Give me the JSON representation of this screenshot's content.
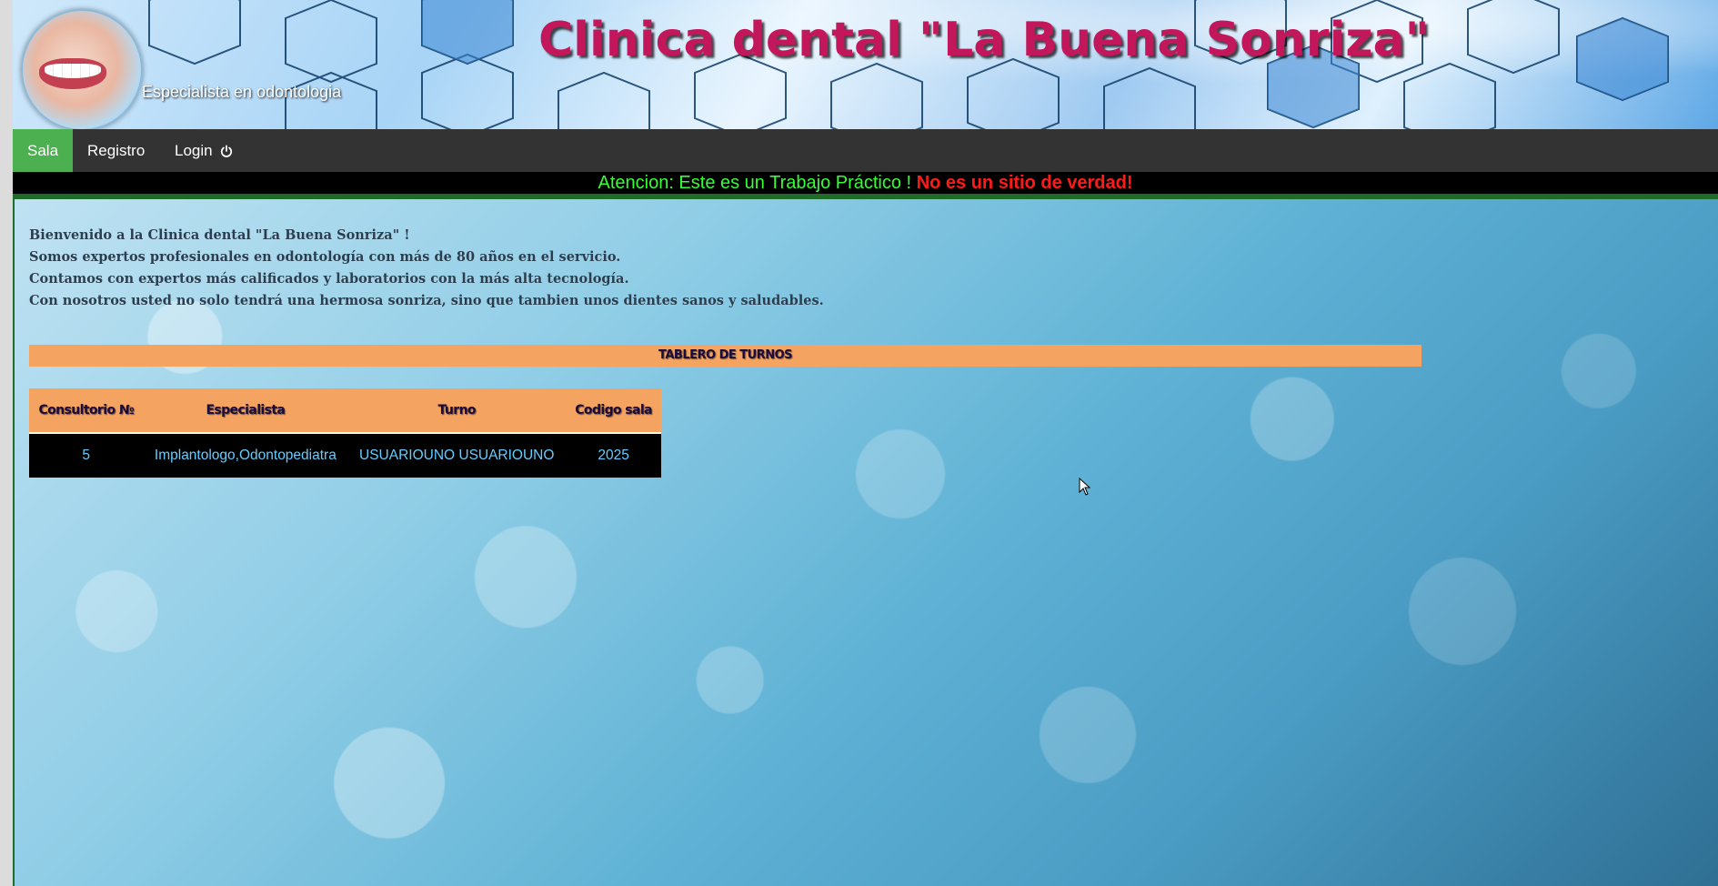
{
  "header": {
    "title": "Clinica dental \"La Buena Sonriza\"",
    "subtitle": "Especialista en odontologia",
    "logo": "smile-logo"
  },
  "nav": {
    "items": [
      {
        "label": "Sala",
        "active": true
      },
      {
        "label": "Registro",
        "active": false
      },
      {
        "label": "Login",
        "active": false,
        "icon": "power-icon"
      }
    ],
    "active_color": "#4caf50",
    "bg_color": "#333333"
  },
  "warning": {
    "green_text": "Atencion: Este es un Trabajo Práctico !",
    "red_text": "No es un sitio de verdad!"
  },
  "main": {
    "welcome_lines": [
      "Bienvenido a la Clinica dental \"La Buena Sonriza\" !",
      "Somos expertos profesionales en odontología con más de 80 años en el servicio.",
      "Contamos con expertos más calificados y laboratorios con la más alta tecnología.",
      "Con nosotros usted no solo tendrá una hermosa sonriza, sino que tambien unos dientes sanos y saludables."
    ],
    "board_title": "TABLERO DE TURNOS",
    "table": {
      "headers": [
        "Consultorio №",
        "Especialista",
        "Turno",
        "Codigo sala"
      ],
      "rows": [
        [
          "5",
          "Implantologo,Odontopediatra",
          "USUARIOUNO USUARIOUNO",
          "2025"
        ]
      ],
      "header_color": "#f4a460"
    }
  }
}
